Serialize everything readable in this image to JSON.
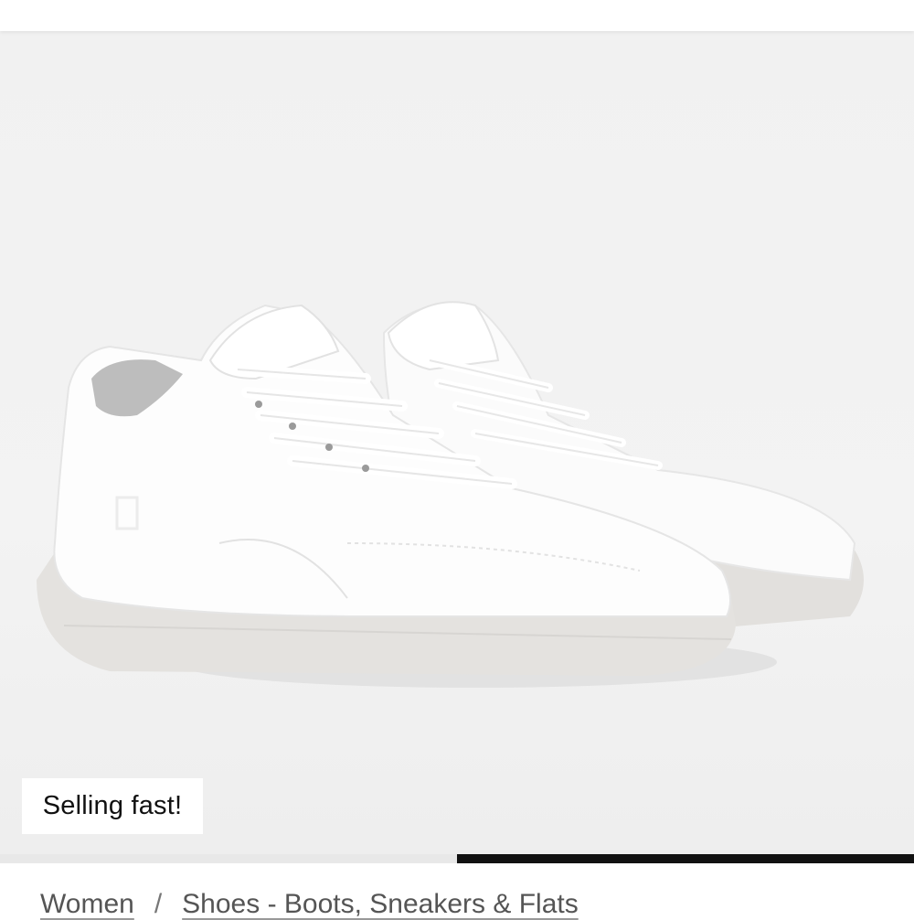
{
  "product": {
    "image_alt": "White leather sneakers",
    "badge": "Selling fast!"
  },
  "gallery": {
    "progress_fraction": 0.5
  },
  "breadcrumb": {
    "items": [
      "Women",
      "Shoes - Boots, Sneakers & Flats"
    ],
    "separator": "/"
  },
  "colors": {
    "background": "#f1f1f1",
    "progress_fill": "#111111",
    "badge_bg": "#ffffff"
  }
}
